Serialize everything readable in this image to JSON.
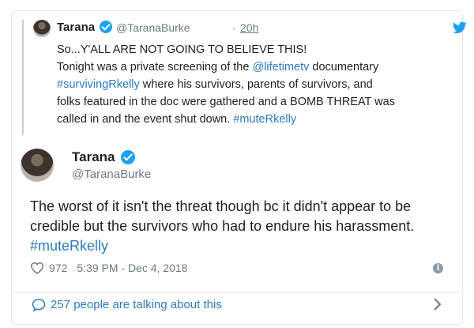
{
  "quoted": {
    "name": "Tarana",
    "handle": "@TaranaBurke",
    "dot": "·",
    "time": "20h",
    "lines": [
      [
        {
          "t": "So...Y'ALL ARE NOT GOING TO BELIEVE THIS!"
        }
      ],
      [
        {
          "t": "Tonight was a private screening of the "
        },
        {
          "t": "@lifetimetv",
          "link": true
        },
        {
          "t": " documentary"
        }
      ],
      [
        {
          "t": "#survivingRkelly",
          "link": true
        },
        {
          "t": " where his survivors, parents of survivors, and"
        }
      ],
      [
        {
          "t": "folks featured in the doc were gathered and a BOMB THREAT was"
        }
      ],
      [
        {
          "t": "called in and the event shut down. "
        },
        {
          "t": "#muteRkelly",
          "link": true
        }
      ]
    ]
  },
  "main": {
    "name": "Tarana",
    "handle": "@TaranaBurke",
    "lines": [
      [
        {
          "t": "The worst of it isn't the threat though bc it didn't appear to be"
        }
      ],
      [
        {
          "t": "credible but the survivors who had to endure his harassment."
        }
      ],
      [
        {
          "t": "#muteRkelly",
          "link": true
        }
      ]
    ],
    "likes": "972",
    "timestamp": "5:39 PM - Dec 4, 2018",
    "info": "i"
  },
  "footer": {
    "talking": "257 people are talking about this"
  },
  "colors": {
    "link": "#2b7bb9",
    "verified": "#1da1f2",
    "muted": "#697882"
  },
  "icons": {
    "verified": "verified-badge-icon",
    "twitter": "twitter-bird-icon",
    "like": "heart-icon",
    "info": "info-icon",
    "reply": "speech-bubble-icon",
    "more": "chevron-right-icon"
  }
}
